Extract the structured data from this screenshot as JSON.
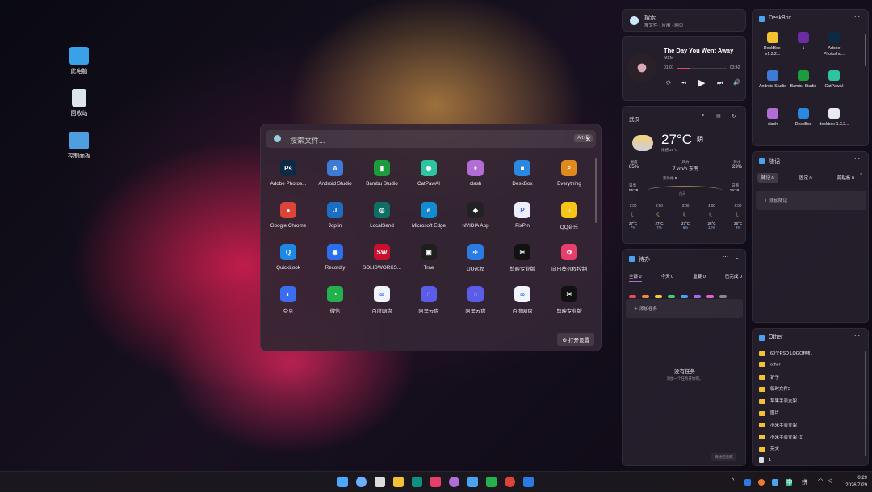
{
  "desktop": {
    "icons": [
      {
        "label": "此电脑",
        "color": "#3aa0e8"
      },
      {
        "label": "回收站",
        "color": "#dde4ea"
      },
      {
        "label": "控制面板",
        "color": "#4e9fe0"
      }
    ]
  },
  "launcher": {
    "search_placeholder": "搜索文件...",
    "shortcut": "Alt+D",
    "settings_button": "打开设置",
    "apps": [
      {
        "label": "Adobe Photos...",
        "icon": "photoshop-icon",
        "glyph": "Ps",
        "color": "#0d2a45"
      },
      {
        "label": "Android Studio",
        "icon": "android-studio-icon",
        "glyph": "A",
        "color": "#3d7bd6"
      },
      {
        "label": "Bambu Studio",
        "icon": "bambu-icon",
        "glyph": "▮",
        "color": "#1d9c3e"
      },
      {
        "label": "CatPawAI",
        "icon": "catpaw-icon",
        "glyph": "◉",
        "color": "#2ec4a0"
      },
      {
        "label": "clash",
        "icon": "clash-icon",
        "glyph": "ᴥ",
        "color": "#b26cd6"
      },
      {
        "label": "DeskBox",
        "icon": "deskbox-icon",
        "glyph": "■",
        "color": "#2a88e0"
      },
      {
        "label": "Everything",
        "icon": "everything-icon",
        "glyph": "⌕",
        "color": "#e08a1d"
      },
      {
        "label": "Google Chrome",
        "icon": "chrome-icon",
        "glyph": "●",
        "color": "#db4437"
      },
      {
        "label": "Joplin",
        "icon": "joplin-icon",
        "glyph": "J",
        "color": "#1b6ec2"
      },
      {
        "label": "LocalSend",
        "icon": "localsend-icon",
        "glyph": "◎",
        "color": "#0f6f63"
      },
      {
        "label": "Microsoft Edge",
        "icon": "edge-icon",
        "glyph": "e",
        "color": "#138bd1"
      },
      {
        "label": "NVIDIA App",
        "icon": "nvidia-icon",
        "glyph": "◆",
        "color": "#222"
      },
      {
        "label": "PixPin",
        "icon": "pixpin-icon",
        "glyph": "P",
        "color": "#eef"
      },
      {
        "label": "QQ音乐",
        "icon": "qqmusic-icon",
        "glyph": "♪",
        "color": "#f5c518"
      },
      {
        "label": "QuickLook",
        "icon": "quicklook-icon",
        "glyph": "Q",
        "color": "#1e88e5"
      },
      {
        "label": "Recordly",
        "icon": "recordly-icon",
        "glyph": "◉",
        "color": "#2b6ff0"
      },
      {
        "label": "SOLIDWORKS...",
        "icon": "solidworks-icon",
        "glyph": "SW",
        "color": "#c8102e"
      },
      {
        "label": "Trae",
        "icon": "trae-icon",
        "glyph": "▣",
        "color": "#1f1f1f"
      },
      {
        "label": "UU远程",
        "icon": "uu-remote-icon",
        "glyph": "✈",
        "color": "#2c7be5"
      },
      {
        "label": "剪映专业版",
        "icon": "capcut-icon",
        "glyph": "✂",
        "color": "#111"
      },
      {
        "label": "向日葵远程控制",
        "icon": "sunlogin-icon",
        "glyph": "✿",
        "color": "#e83e6b"
      },
      {
        "label": "夸克",
        "icon": "quark-icon",
        "glyph": "◐",
        "color": "#3a6df0"
      },
      {
        "label": "微信",
        "icon": "wechat-icon",
        "glyph": "◔",
        "color": "#22b14c"
      },
      {
        "label": "百度网盘",
        "icon": "baidu-netdisk-icon",
        "glyph": "∞",
        "color": "#f0f4ff"
      },
      {
        "label": "阿里云盘",
        "icon": "aliyun-drive-icon",
        "glyph": "◌",
        "color": "#5b5ce8"
      },
      {
        "label": "阿里云盘",
        "icon": "aliyun-drive-icon",
        "glyph": "◌",
        "color": "#5b5ce8"
      },
      {
        "label": "百度网盘",
        "icon": "baidu-netdisk-icon",
        "glyph": "∞",
        "color": "#f0f4ff"
      },
      {
        "label": "剪映专业版",
        "icon": "capcut-icon",
        "glyph": "✂",
        "color": "#111"
      }
    ]
  },
  "search_widget": {
    "title": "搜索",
    "subtitle": "搜文件 · 应用 · 网页"
  },
  "music": {
    "title": "The Day You Went Away",
    "artist": "M2M",
    "elapsed": "01:01",
    "total": "03:42",
    "progress": 0.27
  },
  "weather": {
    "city": "武汉",
    "temp": "27°C",
    "condition": "阴",
    "feels": "体感 29°C",
    "stats": [
      {
        "label": "湿度",
        "value": "85%"
      },
      {
        "label": "风力",
        "value": "7 km/h 东南"
      },
      {
        "label": "降水",
        "value": "23%"
      }
    ],
    "sunrise_label": "日出",
    "sunrise": "05:28",
    "sunset_label": "日落",
    "sunset": "19:19",
    "daylight": "白天",
    "uv_label": "紫外线",
    "uv": "8",
    "hourly": [
      {
        "time": "1:00",
        "temp": "27°C",
        "rain": "7%"
      },
      {
        "time": "2:00",
        "temp": "27°C",
        "rain": "7%"
      },
      {
        "time": "3:00",
        "temp": "27°C",
        "rain": "6%"
      },
      {
        "time": "4:00",
        "temp": "26°C",
        "rain": "12%"
      },
      {
        "time": "5:00",
        "temp": "26°C",
        "rain": "9%"
      }
    ]
  },
  "todo": {
    "title": "待办",
    "filters": [
      "全部 0",
      "今天 0",
      "重要 0",
      "已完成 0"
    ],
    "add_label": "添加任务",
    "empty_title": "没有任务",
    "empty_hint": "添加一个任务开始吧。",
    "clear_done": "清除已完成",
    "dot_colors": [
      "#e94b5b",
      "#f08a3c",
      "#f0c93c",
      "#48c774",
      "#4aa3f0",
      "#9b6cf0",
      "#e35ec8",
      "#888888"
    ]
  },
  "deskbox": {
    "title": "DeskBox",
    "items": [
      {
        "label": "DeskBox-v1.3.2...",
        "icon": "folder-icon",
        "color": "#f2c230"
      },
      {
        "label": "1",
        "icon": "image-file-icon",
        "color": "#6a2ca0"
      },
      {
        "label": "Adobe Photosho...",
        "icon": "photoshop-icon",
        "color": "#0d2a45"
      },
      {
        "label": "Android Studio",
        "icon": "android-studio-icon",
        "color": "#3d7bd6"
      },
      {
        "label": "Bambu Studio",
        "icon": "bambu-icon",
        "color": "#1d9c3e"
      },
      {
        "label": "CatPawAI",
        "icon": "catpaw-icon",
        "color": "#2ec4a0"
      },
      {
        "label": "clash",
        "icon": "clash-icon",
        "color": "#b26cd6"
      },
      {
        "label": "DeskBox",
        "icon": "deskbox-icon",
        "color": "#2a88e0"
      },
      {
        "label": "deskbox-1.3.2...",
        "icon": "chrome-file-icon",
        "color": "#e8eaee"
      }
    ]
  },
  "notes": {
    "title": "随记",
    "tabs": [
      "随记 0",
      "固定 0",
      "剪贴板 0"
    ],
    "add_label": "添加随记"
  },
  "other": {
    "title": "Other",
    "items": [
      {
        "label": "60个PSD LOGO样机",
        "type": "folder"
      },
      {
        "label": "other",
        "type": "folder"
      },
      {
        "label": "铲子",
        "type": "folder"
      },
      {
        "label": "临时文件2",
        "type": "folder"
      },
      {
        "label": "苹果手表支架",
        "type": "folder"
      },
      {
        "label": "图片",
        "type": "folder"
      },
      {
        "label": "小米手表支架",
        "type": "folder"
      },
      {
        "label": "小米手表支架 (1)",
        "type": "folder"
      },
      {
        "label": "英文",
        "type": "folder"
      },
      {
        "label": "1",
        "type": "file"
      }
    ]
  },
  "taskbar": {
    "time": "0:29",
    "date": "2026/7/29",
    "ime_lang": "中",
    "ime_mode": "拼",
    "tray_arrow": "^",
    "apps": [
      {
        "name": "start-icon",
        "color": "#4aa8ff"
      },
      {
        "name": "search-icon",
        "color": "#6ab0ff"
      },
      {
        "name": "task-view-icon",
        "color": "#ddd"
      },
      {
        "name": "file-explorer-icon",
        "color": "#f2c230"
      },
      {
        "name": "localsend-icon",
        "color": "#0f8f80"
      },
      {
        "name": "sunlogin-icon",
        "color": "#e83e6b"
      },
      {
        "name": "clash-icon",
        "color": "#b26cd6"
      },
      {
        "name": "notes-app-icon",
        "color": "#4aa3f0"
      },
      {
        "name": "wechat-icon",
        "color": "#22b14c"
      },
      {
        "name": "chrome-icon",
        "color": "#db4437"
      },
      {
        "name": "uu-remote-icon",
        "color": "#2c7be5"
      }
    ]
  }
}
